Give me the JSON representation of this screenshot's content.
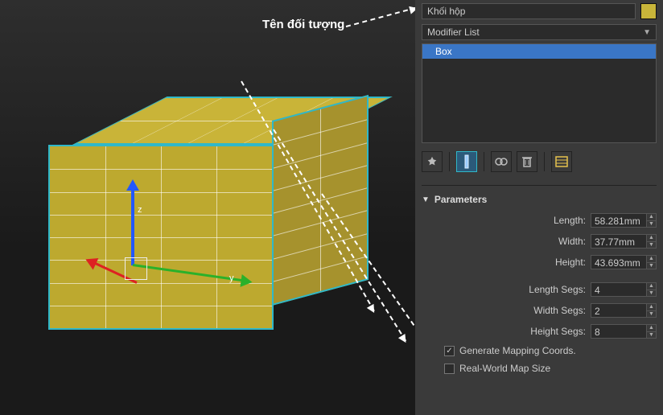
{
  "viewport": {
    "annotation_label": "Tên đối tượng",
    "axis_z_label": "z",
    "axis_y_label": "y"
  },
  "panel": {
    "object_name": "Khối hộp",
    "modifier_list_label": "Modifier List",
    "stack_item": "Box",
    "rollout_title": "Parameters",
    "params": {
      "length_label": "Length:",
      "length_value": "58.281mm",
      "width_label": "Width:",
      "width_value": "37.77mm",
      "height_label": "Height:",
      "height_value": "43.693mm",
      "length_segs_label": "Length Segs:",
      "length_segs_value": "4",
      "width_segs_label": "Width Segs:",
      "width_segs_value": "2",
      "height_segs_label": "Height Segs:",
      "height_segs_value": "8",
      "gen_mapping_label": "Generate Mapping Coords.",
      "gen_mapping_checked": true,
      "real_world_label": "Real-World Map Size",
      "real_world_checked": false
    },
    "object_color": "#c8b53a"
  }
}
